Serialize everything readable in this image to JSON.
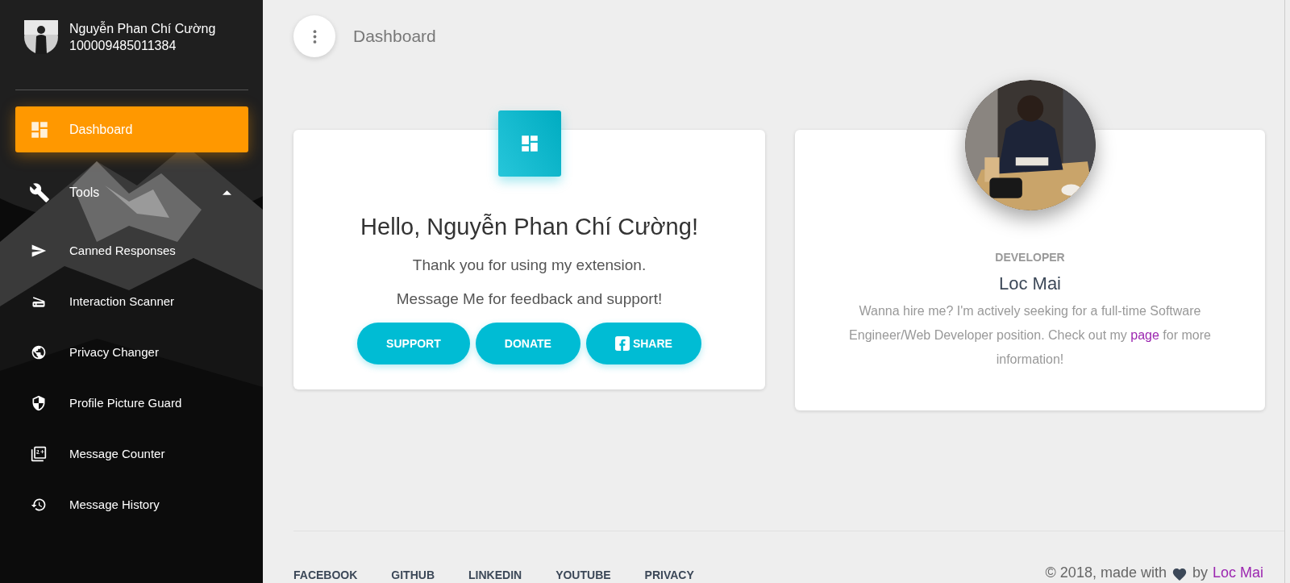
{
  "sidebar": {
    "user": {
      "name": "Nguyễn Phan Chí Cường",
      "id": "100009485011384"
    },
    "items": [
      {
        "label": "Dashboard",
        "selected": true
      },
      {
        "label": "Tools",
        "selected": false,
        "expanded": true,
        "children": [
          {
            "label": "Canned Responses",
            "selected": false
          },
          {
            "label": "Interaction Scanner",
            "selected": false
          },
          {
            "label": "Privacy Changer",
            "selected": false
          },
          {
            "label": "Profile Picture Guard",
            "selected": false
          },
          {
            "label": "Message Counter",
            "selected": false
          },
          {
            "label": "Message History",
            "selected": false
          }
        ]
      }
    ]
  },
  "header": {
    "title": "Dashboard"
  },
  "welcome_card": {
    "greeting": "Hello, Nguyễn Phan Chí Cường!",
    "lines": [
      "Thank you for using my extension.",
      "Message Me for feedback and support!"
    ],
    "buttons": [
      {
        "label": "SUPPORT"
      },
      {
        "label": "DONATE"
      },
      {
        "label": "SHARE"
      }
    ]
  },
  "developer_card": {
    "role": "DEVELOPER",
    "name": "Loc Mai",
    "bio_before": "Wanna hire me? I'm actively seeking for a full-time Software Engineer/Web Developer position. Check out my",
    "link": "page",
    "bio_after": "for more information!"
  },
  "footer": {
    "links": [
      "FACEBOOK",
      "GITHUB",
      "LINKEDIN",
      "YOUTUBE",
      "PRIVACY"
    ],
    "credit_before": "© 2018, made with",
    "credit_between": "by",
    "credit_link": "Loc Mai"
  }
}
